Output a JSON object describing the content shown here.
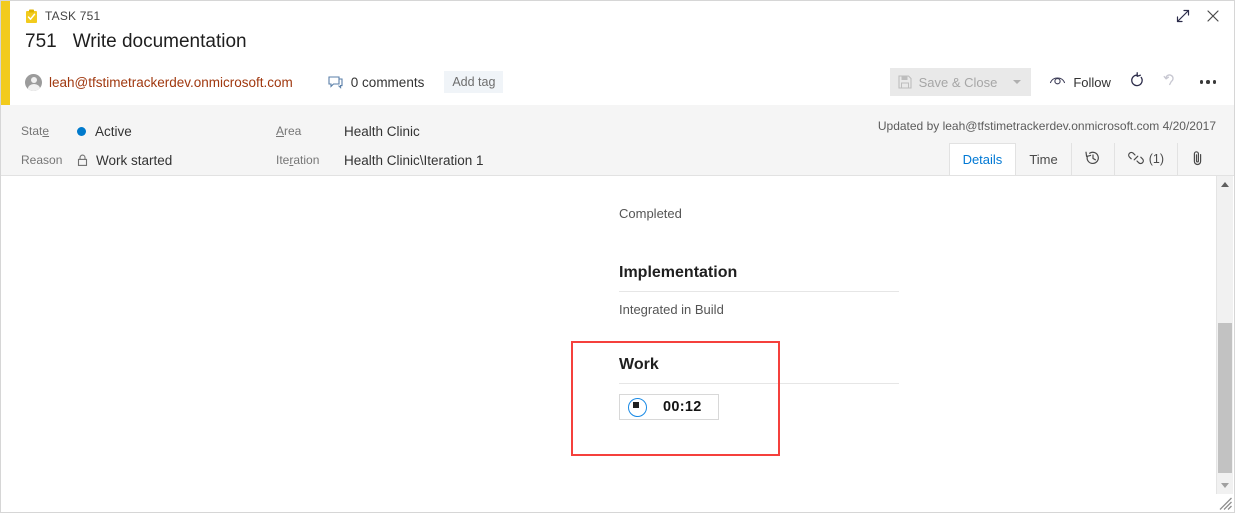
{
  "window": {
    "type_label": "TASK 751",
    "type_icon": "clipboard-check-icon",
    "expand_icon": "expand-icon",
    "close_icon": "close-icon"
  },
  "header": {
    "work_item_id": "751",
    "title": "Write documentation",
    "assigned_to": "leah@tfstimetrackerdev.onmicrosoft.com",
    "avatar_icon": "person-avatar-icon",
    "comments_label": "0 comments",
    "comments_icon": "comment-icon",
    "add_tag_label": "Add tag"
  },
  "toolbar": {
    "save_close_label": "Save & Close",
    "save_icon": "save-disk-icon",
    "save_caret_icon": "chevron-down-icon",
    "follow_label": "Follow",
    "follow_icon": "eye-icon",
    "refresh_icon": "refresh-icon",
    "undo_icon": "undo-icon",
    "more_icon": "ellipsis-icon"
  },
  "fields": {
    "state": {
      "label": "State",
      "label_pre": "Stat",
      "label_accel": "e",
      "label_post": "",
      "value": "Active",
      "dot_color": "#007acc"
    },
    "reason": {
      "label": "Reason",
      "value": "Work started",
      "lock_icon": "lock-icon"
    },
    "area": {
      "label": "Area",
      "label_pre": "",
      "label_accel": "A",
      "label_post": "rea",
      "value": "Health Clinic"
    },
    "iteration": {
      "label": "Iteration",
      "label_pre": "Ite",
      "label_accel": "r",
      "label_post": "ation",
      "value": "Health Clinic\\Iteration 1"
    },
    "updated_by": "Updated by leah@tfstimetrackerdev.onmicrosoft.com 4/20/2017"
  },
  "tabs": [
    {
      "label": "Details",
      "active": true,
      "icon": "",
      "count": ""
    },
    {
      "label": "Time",
      "active": false,
      "icon": "",
      "count": ""
    },
    {
      "label": "",
      "active": false,
      "icon": "history-icon",
      "count": ""
    },
    {
      "label": "",
      "active": false,
      "icon": "link-icon",
      "count": "(1)"
    },
    {
      "label": "",
      "active": false,
      "icon": "attachment-icon",
      "count": ""
    }
  ],
  "content": {
    "completed_text": "Completed",
    "implementation": {
      "title": "Implementation",
      "body": "Integrated in Build"
    },
    "work": {
      "title": "Work",
      "timer_value": "00:12",
      "timer_icon": "stop-timer-icon"
    }
  },
  "scrollbar": {
    "up_icon": "scroll-up-arrow-icon",
    "down_icon": "scroll-down-arrow-icon",
    "grip_icon": "resize-grip-icon"
  },
  "colors": {
    "accent_yellow": "#f2cb1d",
    "link_orange": "#a0380f",
    "active_blue": "#007acc",
    "tab_blue": "#0078d4",
    "highlight_red": "#f5403c"
  }
}
